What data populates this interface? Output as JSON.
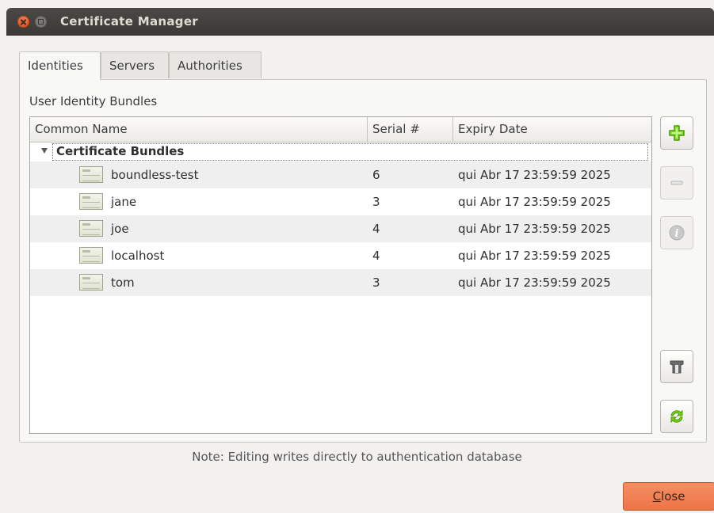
{
  "window": {
    "title": "Certificate Manager"
  },
  "tabs": [
    {
      "label": "Identities",
      "active": true
    },
    {
      "label": "Servers",
      "active": false
    },
    {
      "label": "Authorities",
      "active": false
    }
  ],
  "panel": {
    "section_label": "User Identity Bundles",
    "columns": [
      "Common Name",
      "Serial #",
      "Expiry Date"
    ],
    "group": {
      "label": "Certificate Bundles",
      "expanded": true
    },
    "rows": [
      {
        "common_name": "boundless-test",
        "serial": "6",
        "expiry": "qui Abr 17 23:59:59 2025",
        "icon": "certificate-icon"
      },
      {
        "common_name": "jane",
        "serial": "3",
        "expiry": "qui Abr 17 23:59:59 2025",
        "icon": "certificate-icon"
      },
      {
        "common_name": "joe",
        "serial": "4",
        "expiry": "qui Abr 17 23:59:59 2025",
        "icon": "certificate-icon"
      },
      {
        "common_name": "localhost",
        "serial": "4",
        "expiry": "qui Abr 17 23:59:59 2025",
        "icon": "certificate-icon"
      },
      {
        "common_name": "tom",
        "serial": "3",
        "expiry": "qui Abr 17 23:59:59 2025",
        "icon": "certificate-icon"
      }
    ]
  },
  "side_buttons": [
    {
      "icon": "add-icon",
      "enabled": true
    },
    {
      "icon": "remove-icon",
      "enabled": false
    },
    {
      "icon": "info-icon",
      "enabled": false
    },
    {
      "icon": "filter-icon",
      "enabled": true
    },
    {
      "icon": "refresh-icon",
      "enabled": true
    }
  ],
  "footer": {
    "note": "Note: Editing writes directly to authentication database",
    "close_label_mnemonic": "C",
    "close_label_rest": "lose"
  },
  "colors": {
    "accent_orange": "#ec7448",
    "titlebar": "#3c3b37",
    "add_green": "#4e9a06"
  }
}
